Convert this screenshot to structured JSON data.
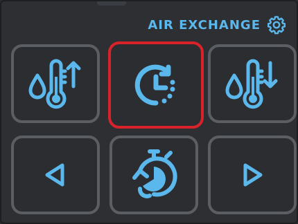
{
  "header": {
    "title": "AIR EXCHANGE",
    "settings_icon": "gear-icon"
  },
  "colors": {
    "accent": "#5bb8ec",
    "button_border": "#5b5e63",
    "selected_border": "#d8232b",
    "background": "#2d2f33"
  },
  "buttons": [
    {
      "icon": "humidity-temperature-up-icon",
      "selected": false
    },
    {
      "icon": "timer-clock-icon",
      "selected": true
    },
    {
      "icon": "humidity-temperature-down-icon",
      "selected": false
    },
    {
      "icon": "arrow-left-icon",
      "selected": false
    },
    {
      "icon": "stopwatch-icon",
      "selected": false
    },
    {
      "icon": "arrow-right-icon",
      "selected": false
    }
  ]
}
